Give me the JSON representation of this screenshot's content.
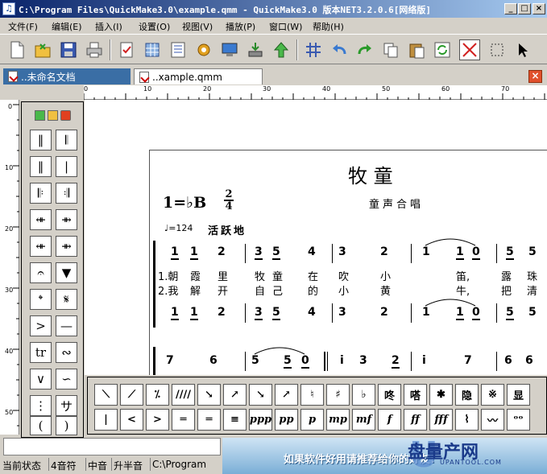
{
  "window": {
    "title": "C:\\Program Files\\QuickMake3.0\\example.qmm - QuickMake3.0 版本NET3.2.0.6[网络版]",
    "controls": [
      "_",
      "□",
      "×"
    ]
  },
  "menu": [
    "文件(F)",
    "编辑(E)",
    "插入(I)",
    "设置(O)",
    "视图(V)",
    "播放(P)",
    "窗口(W)",
    "帮助(H)"
  ],
  "toolbar": {
    "buttons": [
      "new-icon",
      "open-icon",
      "save-icon",
      "print-icon",
      "check-icon",
      "grid-icon",
      "list-icon",
      "gear-icon",
      "monitor-icon",
      "download-icon",
      "up-arrow-icon",
      "hash-icon",
      "undo-icon",
      "redo-icon",
      "copy-icon",
      "paste-icon",
      "refresh-icon",
      "close-x-icon",
      "select-icon",
      "cursor-icon"
    ]
  },
  "tabs": [
    {
      "label": "..未命名文档",
      "active": false
    },
    {
      "label": "..xample.qmm",
      "active": true
    }
  ],
  "ruler": {
    "h_ticks": [
      "0",
      "10",
      "20",
      "30",
      "40",
      "50",
      "60",
      "70"
    ],
    "v_ticks": [
      "0",
      "10",
      "20",
      "30",
      "40",
      "50"
    ]
  },
  "palette": {
    "buttons": [
      "‖",
      "𝄃",
      "‖",
      "|",
      "𝄆",
      "𝄇",
      "⇺",
      "⇻",
      "⇺",
      "⇻",
      "𝄐",
      "▼",
      "𝄌",
      "𝄋",
      ">",
      "—",
      "tr",
      "∾",
      "∨",
      "∽",
      "⋮",
      "サ",
      "(",
      ")"
    ]
  },
  "score": {
    "title": "牧    童",
    "key": "1=♭B",
    "time_top": "2",
    "time_bottom": "4",
    "subtitle": "童声合唱",
    "tempo": "♩=124",
    "tempo_text": "活跃地",
    "line1_notes": [
      "1",
      "1",
      "2",
      "3",
      "5",
      "4",
      "3",
      "2",
      "1",
      "1",
      "0",
      "5",
      "5"
    ],
    "lyrics1": [
      "1.朝",
      "霞",
      "里",
      "牧",
      "童",
      "在",
      "吹",
      "小",
      "笛,",
      "露",
      "珠"
    ],
    "lyrics2": [
      "2.我",
      "解",
      "开",
      "自",
      "己",
      "的",
      "小",
      "黄",
      "牛,",
      "把",
      "清"
    ],
    "line2_notes": [
      "1",
      "1",
      "2",
      "3",
      "5",
      "4",
      "3",
      "2",
      "1",
      "1",
      "0",
      "5",
      "5"
    ],
    "line3_notes": [
      "7",
      "6",
      "5",
      "5",
      "0",
      "i",
      "3",
      "2",
      "i",
      "7",
      "6",
      "6"
    ]
  },
  "symbols": {
    "row1": [
      "⟍",
      "⟋",
      "⁒",
      "////",
      "↘",
      "↗",
      "↘",
      "↗",
      "♮",
      "♯",
      "♭",
      "咚",
      "嗒",
      "✱",
      "隐",
      "※",
      "显"
    ],
    "row2": [
      "|",
      "<",
      ">",
      "═",
      "═",
      "≡",
      "ppp",
      "pp",
      "p",
      "mp",
      "mf",
      "f",
      "ff",
      "fff",
      "⌇",
      "〰",
      "ᵒᵒ"
    ]
  },
  "banner": {
    "text": "如果软件好用请推荐给你的好友!",
    "logo": "盘量产网",
    "logo_sub": "UPANTOOL.COM"
  },
  "status": [
    "当前状态",
    "4音符",
    "中音",
    "升半音",
    "C:\\Program"
  ]
}
